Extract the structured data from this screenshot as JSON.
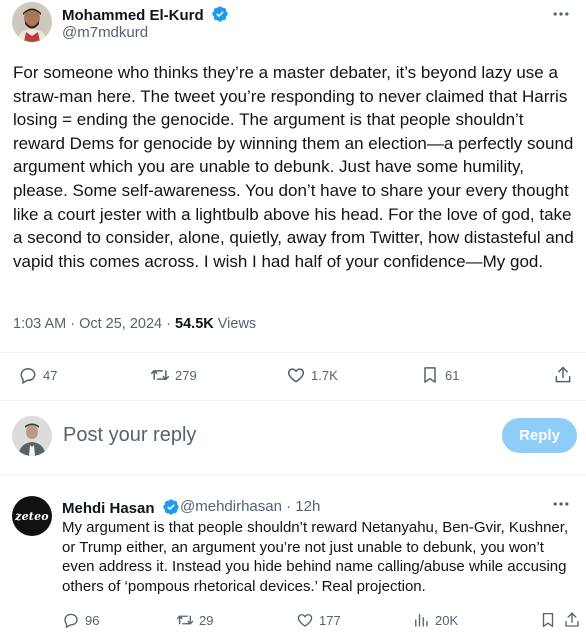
{
  "tweet": {
    "author_name": "Mohammed El-Kurd",
    "author_handle": "@m7mdkurd",
    "text": "For someone who thinks they’re a master debater, it’s beyond lazy use a straw-man here. The tweet you’re responding to never claimed that Harris losing = ending the genocide. The argument is that people shouldn’t reward Dems for genocide by winning them an election—a perfectly sound argument which you are unable to debunk. Just have some humility, please. Some self-awareness. You don’t have to share your every thought like a court jester with a lightbulb above his head. For the love of god, take a second to consider, alone, quietly, away from Twitter, how distasteful and vapid this comes across. I wish I had half of your confidence—My god.",
    "timestamp": "1:03 AM · Oct 25, 2024",
    "separator": "·",
    "views_count": "54.5K",
    "views_label": "Views",
    "stats": {
      "replies": "47",
      "reposts": "279",
      "likes": "1.7K",
      "bookmarks": "61"
    }
  },
  "composer": {
    "placeholder": "Post your reply",
    "button_label": "Reply"
  },
  "reply": {
    "author_name": "Mehdi Hasan",
    "author_handle": "@mehdirhasan · 12h",
    "avatar_text": "zeteo",
    "text": "My argument is that people shouldn’t reward Netanyahu, Ben-Gvir, Kushner, or Trump either, an argument you’re not just unable to debunk, you won’t even address it. Instead you hide behind name calling/abuse while accusing others of ‘pompous rhetorical devices.’ Real projection.",
    "stats": {
      "replies": "96",
      "reposts": "29",
      "likes": "177",
      "views": "20K"
    }
  },
  "colors": {
    "verified": "#1d9bf0",
    "muted": "#536471",
    "reply_button": "#8ecdf8",
    "divider": "#eff3f4"
  }
}
